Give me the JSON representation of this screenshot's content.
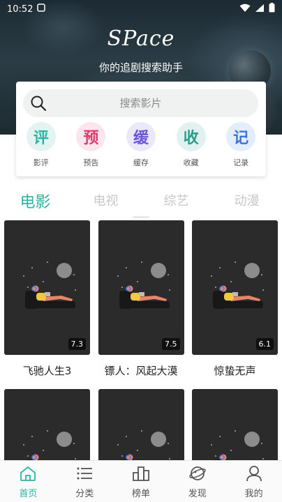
{
  "status_bar": {
    "time": "10:52",
    "left_icon": "notification-icon",
    "right_icons": [
      "wifi-icon",
      "signal-icon",
      "battery-icon"
    ]
  },
  "header": {
    "brand": "SPace",
    "slogan": "你的追剧搜索助手"
  },
  "search": {
    "placeholder": "搜索影片"
  },
  "quick_actions": [
    {
      "glyph": "评",
      "label": "影评",
      "color": "#2bb5a0",
      "bg": "#e3f3f1"
    },
    {
      "glyph": "预",
      "label": "预告",
      "color": "#e0396b",
      "bg": "#fbe6ed"
    },
    {
      "glyph": "缓",
      "label": "缓存",
      "color": "#6a56d8",
      "bg": "#ebe8fb"
    },
    {
      "glyph": "收",
      "label": "收藏",
      "color": "#2a9d8a",
      "bg": "#e1f1ef"
    },
    {
      "glyph": "记",
      "label": "记录",
      "color": "#3c74d8",
      "bg": "#e4edfb"
    }
  ],
  "tabs": [
    {
      "label": "电影",
      "active": true
    },
    {
      "label": "电视",
      "active": false
    },
    {
      "label": "综艺",
      "active": false
    },
    {
      "label": "动漫",
      "active": false
    }
  ],
  "movies": [
    {
      "title": "飞驰人生3",
      "rating": "7.3"
    },
    {
      "title": "镖人：风起大漠",
      "rating": "7.5"
    },
    {
      "title": "惊蛰无声",
      "rating": "6.1"
    },
    {
      "title": "",
      "rating": ""
    },
    {
      "title": "",
      "rating": ""
    },
    {
      "title": "",
      "rating": ""
    }
  ],
  "bottom_nav": [
    {
      "label": "首页",
      "icon": "home-icon",
      "active": true
    },
    {
      "label": "分类",
      "icon": "list-icon",
      "active": false
    },
    {
      "label": "榜单",
      "icon": "ranking-icon",
      "active": false
    },
    {
      "label": "发现",
      "icon": "discover-icon",
      "active": false
    },
    {
      "label": "我的",
      "icon": "user-icon",
      "active": false
    }
  ],
  "colors": {
    "accent": "#2bb5a0",
    "poster_bg": "#2b2b2b"
  }
}
